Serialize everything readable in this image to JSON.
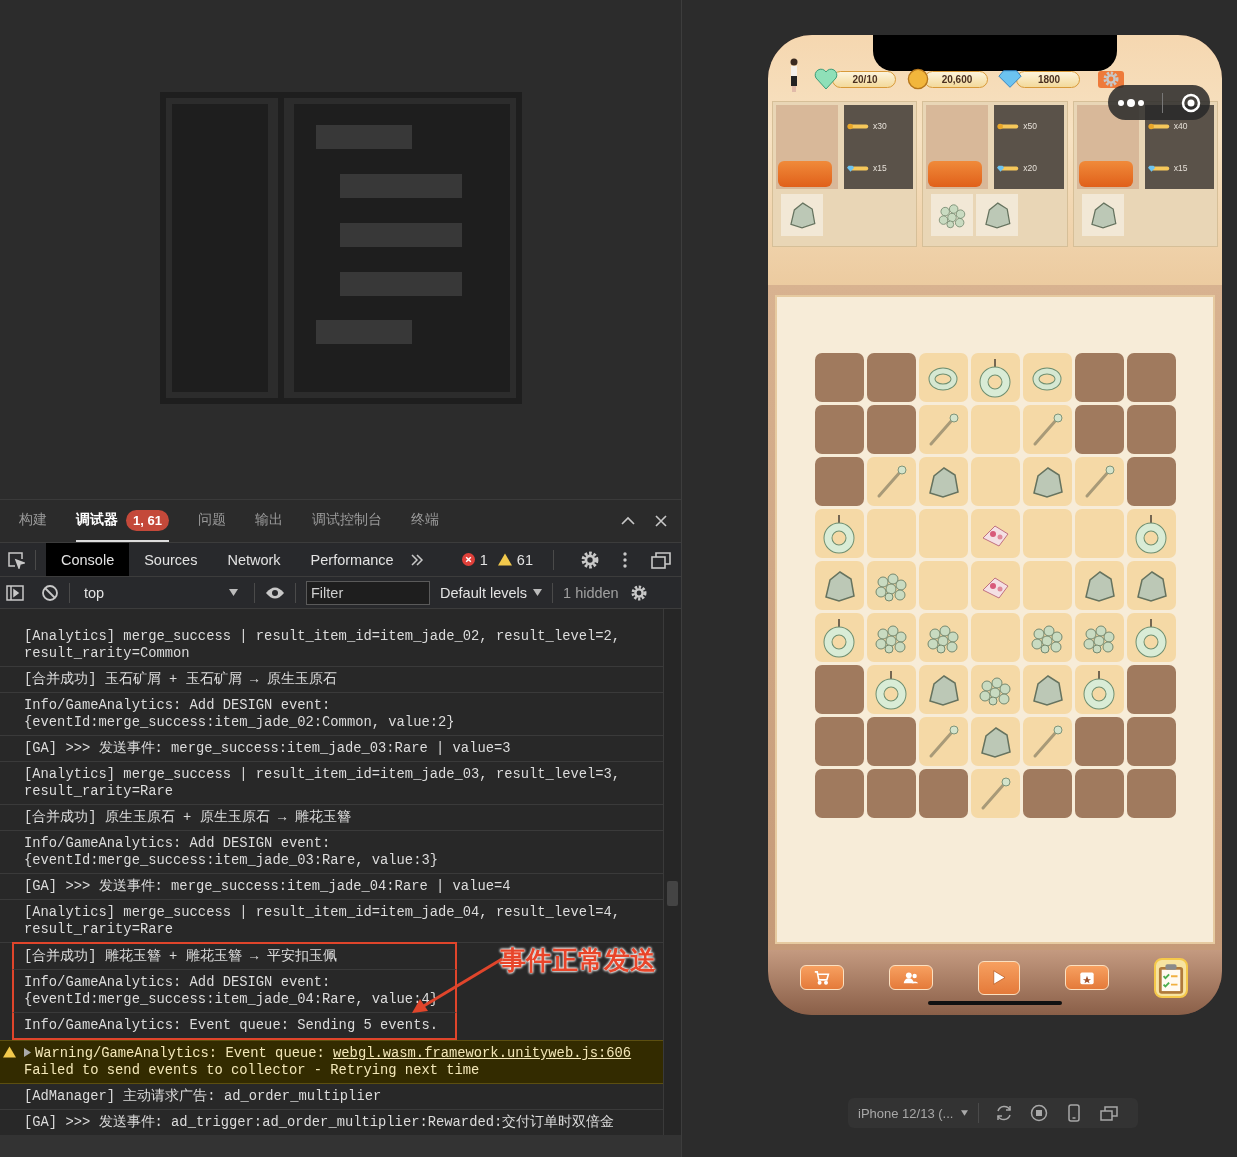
{
  "panel_tabs": [
    {
      "label": "构建",
      "selected": false
    },
    {
      "label": "调试器",
      "selected": true,
      "badge": "1, 61"
    },
    {
      "label": "问题",
      "selected": false
    },
    {
      "label": "输出",
      "selected": false
    },
    {
      "label": "调试控制台",
      "selected": false
    },
    {
      "label": "终端",
      "selected": false
    }
  ],
  "devtools_tabs": [
    {
      "label": "Console",
      "selected": true
    },
    {
      "label": "Sources",
      "selected": false
    },
    {
      "label": "Network",
      "selected": false
    },
    {
      "label": "Performance",
      "selected": false
    }
  ],
  "counts": {
    "errors": "1",
    "warnings": "61"
  },
  "console_toolbar": {
    "context": "top",
    "filter_placeholder": "Filter",
    "levels": "Default levels",
    "hidden": "1 hidden"
  },
  "console": [
    {
      "kind": "log",
      "highlighted": false,
      "lines": [
        "[Analytics] merge_success | result_item_id=item_jade_02, result_level=2,",
        "result_rarity=Common"
      ]
    },
    {
      "kind": "log",
      "highlighted": false,
      "lines": [
        "[合并成功] 玉石矿屑 + 玉石矿屑 → 原生玉原石"
      ]
    },
    {
      "kind": "log",
      "highlighted": false,
      "lines": [
        "Info/GameAnalytics: Add DESIGN event:",
        "{eventId:merge_success:item_jade_02:Common, value:2}"
      ]
    },
    {
      "kind": "log",
      "highlighted": false,
      "lines": [
        "[GA] >>> 发送事件: merge_success:item_jade_03:Rare | value=3"
      ]
    },
    {
      "kind": "log",
      "highlighted": false,
      "lines": [
        "[Analytics] merge_success | result_item_id=item_jade_03, result_level=3,",
        "result_rarity=Rare"
      ]
    },
    {
      "kind": "log",
      "highlighted": false,
      "lines": [
        "[合并成功] 原生玉原石 + 原生玉原石 → 雕花玉簪"
      ]
    },
    {
      "kind": "log",
      "highlighted": false,
      "lines": [
        "Info/GameAnalytics: Add DESIGN event:",
        "{eventId:merge_success:item_jade_03:Rare, value:3}"
      ]
    },
    {
      "kind": "log",
      "highlighted": false,
      "lines": [
        "[GA] >>> 发送事件: merge_success:item_jade_04:Rare | value=4"
      ]
    },
    {
      "kind": "log",
      "highlighted": false,
      "lines": [
        "[Analytics] merge_success | result_item_id=item_jade_04, result_level=4,",
        "result_rarity=Rare"
      ]
    },
    {
      "kind": "log",
      "highlighted": true,
      "lines": [
        "[合并成功] 雕花玉簪 + 雕花玉簪 → 平安扣玉佩"
      ]
    },
    {
      "kind": "log",
      "highlighted": true,
      "lines": [
        "Info/GameAnalytics: Add DESIGN event:",
        "{eventId:merge_success:item_jade_04:Rare, value:4}"
      ]
    },
    {
      "kind": "log",
      "highlighted": true,
      "lines": [
        "Info/GameAnalytics: Event queue: Sending 5 events."
      ]
    },
    {
      "kind": "warning",
      "highlighted": false,
      "lines": [
        "Warning/GameAnalytics: Event queue: ",
        "Failed to send events to collector - Retrying next time"
      ],
      "link": "webgl.wasm.framework.unityweb.js:606"
    },
    {
      "kind": "log",
      "highlighted": false,
      "lines": [
        "[AdManager] 主动请求广告: ad_order_multiplier"
      ]
    },
    {
      "kind": "log",
      "highlighted": false,
      "lines": [
        "[GA] >>> 发送事件: ad_trigger:ad_order_multiplier:Rewarded:交付订单时双倍金"
      ]
    }
  ],
  "annotation": {
    "label": "事件正常发送"
  },
  "game": {
    "stats": [
      {
        "kind": "lives",
        "value": "20/10"
      },
      {
        "kind": "coins",
        "value": "20,600"
      },
      {
        "kind": "gems",
        "value": "1800"
      }
    ],
    "orders": [
      {
        "rewards": [
          {
            "kind": "coins",
            "amount": "x30"
          },
          {
            "kind": "gems",
            "amount": "x15"
          }
        ],
        "items": [
          {
            "kind": "stone"
          }
        ]
      },
      {
        "rewards": [
          {
            "kind": "coins",
            "amount": "x50"
          },
          {
            "kind": "gems",
            "amount": "x20"
          }
        ],
        "items": [
          {
            "kind": "pebbles"
          },
          {
            "kind": "stone"
          }
        ]
      },
      {
        "rewards": [
          {
            "kind": "coins",
            "amount": "x40"
          },
          {
            "kind": "gems",
            "amount": "x15"
          }
        ],
        "items": [
          {
            "kind": "stone"
          }
        ]
      }
    ],
    "board": [
      {
        "cells": [
          {
            "kind": "locked"
          },
          {
            "kind": "locked"
          },
          {
            "kind": "ring"
          },
          {
            "kind": "pendant"
          },
          {
            "kind": "ring"
          },
          {
            "kind": "locked"
          },
          {
            "kind": "locked"
          }
        ]
      },
      {
        "cells": [
          {
            "kind": "locked"
          },
          {
            "kind": "locked"
          },
          {
            "kind": "hairpin"
          },
          {
            "kind": "empty"
          },
          {
            "kind": "hairpin"
          },
          {
            "kind": "locked"
          },
          {
            "kind": "locked"
          }
        ]
      },
      {
        "cells": [
          {
            "kind": "locked"
          },
          {
            "kind": "hairpin"
          },
          {
            "kind": "stone"
          },
          {
            "kind": "empty"
          },
          {
            "kind": "stone"
          },
          {
            "kind": "hairpin"
          },
          {
            "kind": "locked"
          }
        ]
      },
      {
        "cells": [
          {
            "kind": "pendant"
          },
          {
            "kind": "empty"
          },
          {
            "kind": "empty"
          },
          {
            "kind": "gift"
          },
          {
            "kind": "empty"
          },
          {
            "kind": "empty"
          },
          {
            "kind": "pendant"
          }
        ]
      },
      {
        "cells": [
          {
            "kind": "stone"
          },
          {
            "kind": "pebbles"
          },
          {
            "kind": "empty"
          },
          {
            "kind": "gift"
          },
          {
            "kind": "empty"
          },
          {
            "kind": "stone"
          },
          {
            "kind": "stone"
          }
        ]
      },
      {
        "cells": [
          {
            "kind": "pendant"
          },
          {
            "kind": "pebbles"
          },
          {
            "kind": "pebbles"
          },
          {
            "kind": "empty"
          },
          {
            "kind": "pebbles"
          },
          {
            "kind": "pebbles"
          },
          {
            "kind": "pendant"
          }
        ]
      },
      {
        "cells": [
          {
            "kind": "locked"
          },
          {
            "kind": "pendant"
          },
          {
            "kind": "stone"
          },
          {
            "kind": "pebbles"
          },
          {
            "kind": "stone"
          },
          {
            "kind": "pendant"
          },
          {
            "kind": "locked"
          }
        ]
      },
      {
        "cells": [
          {
            "kind": "locked"
          },
          {
            "kind": "locked"
          },
          {
            "kind": "hairpin"
          },
          {
            "kind": "stone"
          },
          {
            "kind": "hairpin"
          },
          {
            "kind": "locked"
          },
          {
            "kind": "locked"
          }
        ]
      },
      {
        "cells": [
          {
            "kind": "locked"
          },
          {
            "kind": "locked"
          },
          {
            "kind": "locked"
          },
          {
            "kind": "hairpin"
          },
          {
            "kind": "locked"
          },
          {
            "kind": "locked"
          },
          {
            "kind": "locked"
          }
        ]
      }
    ],
    "dock": [
      {
        "kind": "shop"
      },
      {
        "kind": "friends"
      },
      {
        "kind": "play"
      },
      {
        "kind": "calendar"
      },
      {
        "kind": "tasks"
      }
    ]
  },
  "simulator": {
    "device": "iPhone 12/13 (..."
  }
}
